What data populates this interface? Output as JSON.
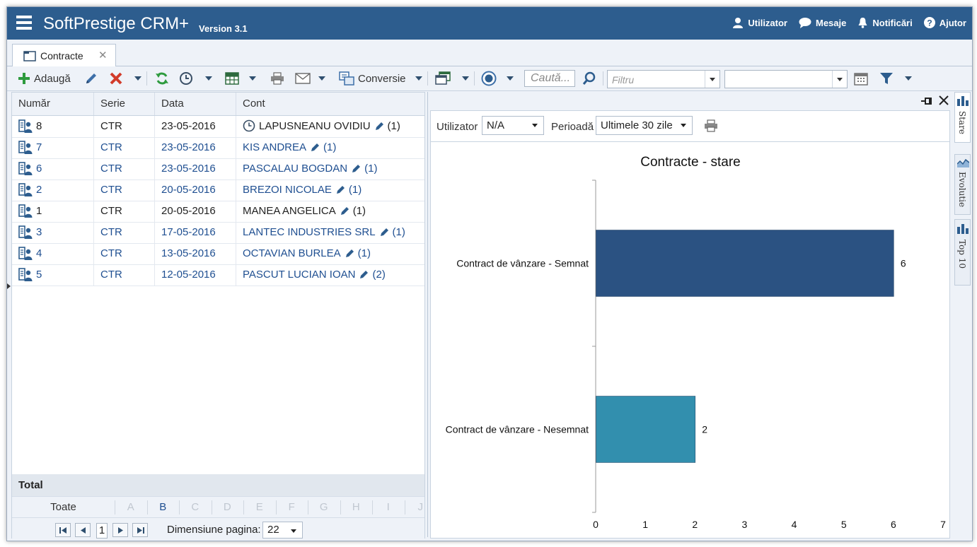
{
  "app": {
    "title": "SoftPrestige CRM+",
    "version": "Version 3.1",
    "top_links": [
      {
        "label": "Utilizator",
        "icon": "user-icon"
      },
      {
        "label": "Mesaje",
        "icon": "chat-bubble-icon"
      },
      {
        "label": "Notificări",
        "icon": "bell-icon"
      },
      {
        "label": "Ajutor",
        "icon": "help-icon"
      }
    ]
  },
  "tabs": [
    {
      "label": "Contracte",
      "close": "✕"
    }
  ],
  "toolbar": {
    "add_label": "Adaugă",
    "conversion_label": "Conversie",
    "search_placeholder": "Caută...",
    "filter_placeholder": "Filtru"
  },
  "grid": {
    "columns": [
      "Număr",
      "Serie",
      "Data",
      "Cont"
    ],
    "rows": [
      {
        "number": "8",
        "series": "CTR",
        "date": "23-05-2016",
        "account": "LAPUSNEANU OVIDIU",
        "count": "(1)",
        "style": "dark",
        "clock": true
      },
      {
        "number": "7",
        "series": "CTR",
        "date": "23-05-2016",
        "account": "KIS ANDREA",
        "count": "(1)",
        "style": "blue",
        "clock": false
      },
      {
        "number": "6",
        "series": "CTR",
        "date": "23-05-2016",
        "account": "PASCALAU BOGDAN",
        "count": "(1)",
        "style": "blue",
        "clock": false
      },
      {
        "number": "2",
        "series": "CTR",
        "date": "20-05-2016",
        "account": "BREZOI NICOLAE",
        "count": "(1)",
        "style": "blue",
        "clock": false
      },
      {
        "number": "1",
        "series": "CTR",
        "date": "20-05-2016",
        "account": "MANEA ANGELICA",
        "count": "(1)",
        "style": "dark",
        "clock": false
      },
      {
        "number": "3",
        "series": "CTR",
        "date": "17-05-2016",
        "account": "LANTEC INDUSTRIES SRL",
        "count": "(1)",
        "style": "blue",
        "clock": false
      },
      {
        "number": "4",
        "series": "CTR",
        "date": "13-05-2016",
        "account": "OCTAVIAN BURLEA",
        "count": "(1)",
        "style": "blue",
        "clock": false
      },
      {
        "number": "5",
        "series": "CTR",
        "date": "12-05-2016",
        "account": "PASCUT LUCIAN IOAN",
        "count": "(2)",
        "style": "blue",
        "clock": false
      }
    ],
    "total_label": "Total",
    "alpha_all": "Toate",
    "alpha_letters": [
      {
        "letter": "A",
        "active": false
      },
      {
        "letter": "B",
        "active": true
      },
      {
        "letter": "C",
        "active": false
      },
      {
        "letter": "D",
        "active": false
      },
      {
        "letter": "E",
        "active": false
      },
      {
        "letter": "F",
        "active": false
      },
      {
        "letter": "G",
        "active": false
      },
      {
        "letter": "H",
        "active": false
      },
      {
        "letter": "I",
        "active": false
      },
      {
        "letter": "J",
        "active": false
      }
    ],
    "pager": {
      "current_page": "1",
      "page_size_label": "Dimensiune pagina:",
      "page_size": "22"
    }
  },
  "chart_panel": {
    "user_label": "Utilizator",
    "user_value": "N/A",
    "period_label": "Perioadă",
    "period_value": "Ultimele 30 zile"
  },
  "chart_data": {
    "type": "bar",
    "orientation": "horizontal",
    "title": "Contracte - stare",
    "categories": [
      "Contract de vânzare - Semnat",
      "Contract de vânzare - Nesemnat"
    ],
    "values": [
      6,
      2
    ],
    "colors": [
      "#2b5282",
      "#328fae"
    ],
    "xlim": [
      0,
      7
    ],
    "xticks": [
      0,
      1,
      2,
      3,
      4,
      5,
      6,
      7
    ],
    "xlabel": "",
    "ylabel": "",
    "grid": false,
    "legend": "none"
  },
  "side_tabs": [
    "Stare",
    "Evolutie",
    "Top 10"
  ],
  "colors": {
    "header": "#2d5d8e",
    "link_blue": "#1f4f91",
    "add_green": "#2e9b3e",
    "delete_red": "#d23b2a"
  }
}
